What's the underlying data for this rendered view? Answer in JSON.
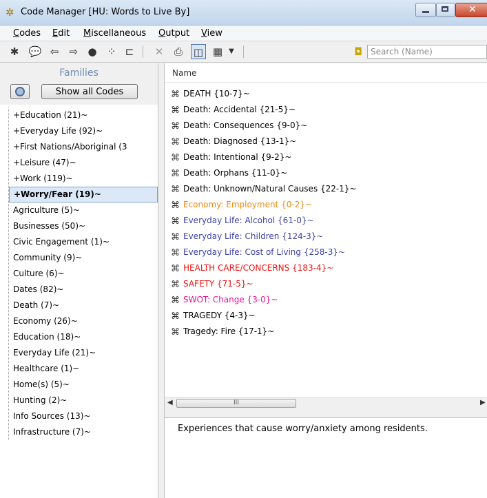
{
  "window": {
    "title": "Code Manager [HU: Words to Live By]"
  },
  "menus": [
    "Codes",
    "Edit",
    "Miscellaneous",
    "Output",
    "View"
  ],
  "search": {
    "placeholder": "Search (Name)"
  },
  "families": {
    "title": "Families",
    "show_all_label": "Show all Codes",
    "items": [
      "+Education (21)~",
      "+Everyday Life (92)~",
      "+First Nations/Aboriginal (3",
      "+Leisure (47)~",
      "+Work (119)~",
      "+Worry/Fear (19)~",
      "Agriculture (5)~",
      "Businesses (50)~",
      "Civic Engagement (1)~",
      "Community (9)~",
      "Culture (6)~",
      "Dates (82)~",
      "Death (7)~",
      "Economy (26)~",
      "Education (18)~",
      "Everyday Life (21)~",
      "Healthcare (1)~",
      "Home(s) (5)~",
      "Hunting (2)~",
      "Info Sources (13)~",
      "Infrastructure (7)~"
    ],
    "selected_index": 5
  },
  "codes": {
    "column_name": "Name",
    "items": [
      {
        "label": "DEATH {10-7}~",
        "color": "#000000"
      },
      {
        "label": "Death: Accidental {21-5}~",
        "color": "#000000"
      },
      {
        "label": "Death: Consequences {9-0}~",
        "color": "#000000"
      },
      {
        "label": "Death: Diagnosed {13-1}~",
        "color": "#000000"
      },
      {
        "label": "Death: Intentional {9-2}~",
        "color": "#000000"
      },
      {
        "label": "Death: Orphans {11-0}~",
        "color": "#000000"
      },
      {
        "label": "Death: Unknown/Natural Causes {22-1}~",
        "color": "#000000"
      },
      {
        "label": "Economy: Employment {0-2}~",
        "color": "#f08a12"
      },
      {
        "label": "Everyday Life: Alcohol {61-0}~",
        "color": "#3b3fa8"
      },
      {
        "label": "Everyday Life: Children {124-3}~",
        "color": "#3b3fa8"
      },
      {
        "label": "Everyday Life: Cost of Living {258-3}~",
        "color": "#3b3fa8"
      },
      {
        "label": "HEALTH CARE/CONCERNS {183-4}~",
        "color": "#ee1111"
      },
      {
        "label": "SAFETY {71-5}~",
        "color": "#ee1111"
      },
      {
        "label": "SWOT: Change {3-0}~",
        "color": "#e8129a"
      },
      {
        "label": "TRAGEDY {4-3}~",
        "color": "#000000"
      },
      {
        "label": "Tragedy: Fire {17-1}~",
        "color": "#000000"
      }
    ]
  },
  "scrollbar": {
    "thumb_grip": "III"
  },
  "comment": {
    "text": "Experiences that cause worry/anxiety among residents."
  }
}
